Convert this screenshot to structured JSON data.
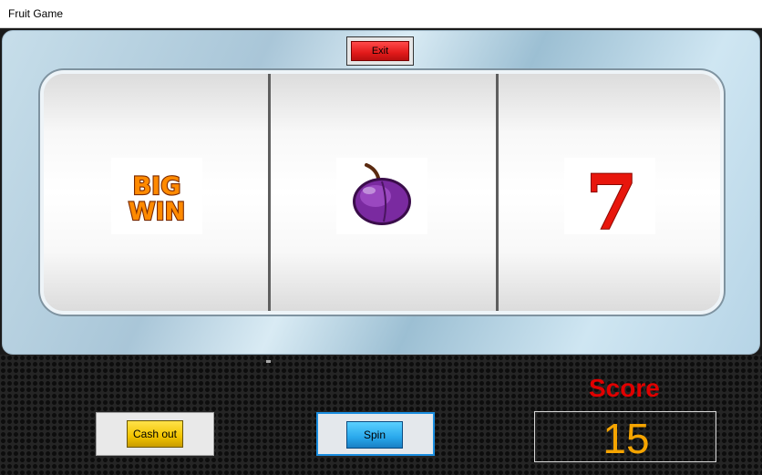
{
  "window": {
    "title": "Fruit Game"
  },
  "buttons": {
    "exit_label": "Exit",
    "cash_out_label": "Cash out",
    "spin_label": "Spin"
  },
  "reels": [
    {
      "symbol": "big-win",
      "text": "BIG WIN"
    },
    {
      "symbol": "plum"
    },
    {
      "symbol": "seven",
      "text": "7"
    }
  ],
  "score": {
    "label": "Score",
    "value": "15"
  },
  "colors": {
    "score_label": "#e00000",
    "score_value": "#f5a400",
    "exit_button": "#e21a1a",
    "cash_out_button": "#f2c400",
    "spin_button": "#29a8ec",
    "spin_panel_border": "#1a8ee0"
  }
}
